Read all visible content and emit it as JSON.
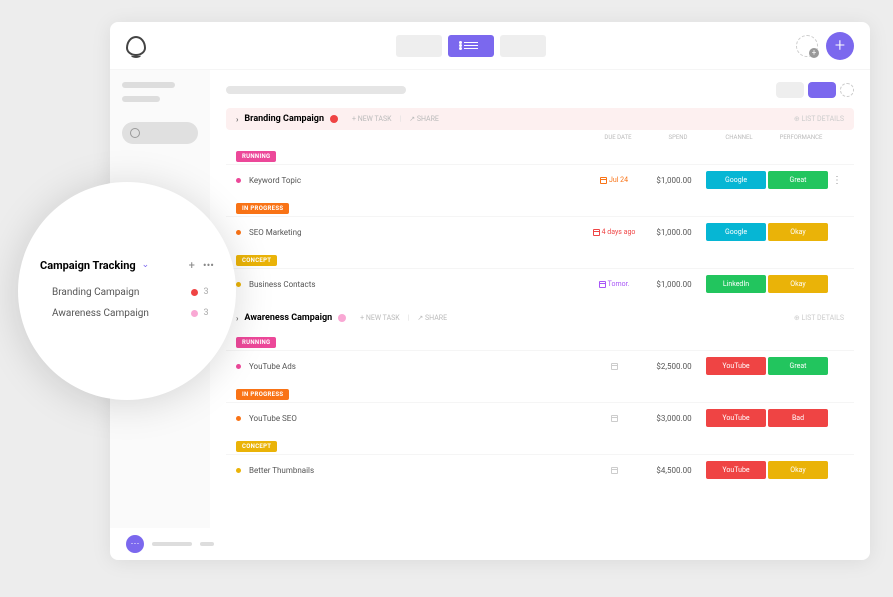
{
  "colors": {
    "purple": "#7b68ee",
    "pink": "#ec4899",
    "orange": "#f97316",
    "yellow": "#eab308",
    "red": "#ef4444",
    "green": "#22c55e",
    "blue": "#3b82f6",
    "gold": "#facc15"
  },
  "popup": {
    "title": "Campaign Tracking",
    "items": [
      {
        "label": "Branding Campaign",
        "dot": "#ef4444",
        "count": "3"
      },
      {
        "label": "Awareness Campaign",
        "dot": "#f9a8d4",
        "count": "3"
      }
    ]
  },
  "groups": [
    {
      "title": "Branding Campaign",
      "dot": "#ef4444",
      "headbg": "pink",
      "newtask": "+ NEW TASK",
      "share": "↗ SHARE",
      "details": "⊕ LIST DETAILS",
      "cols": {
        "c2": "DUE DATE",
        "c3": "SPEND",
        "c4": "CHANNEL",
        "c5": "PERFORMANCE"
      },
      "sections": [
        {
          "tag": "RUNNING",
          "tagc": "#ec4899",
          "rows": [
            {
              "bullet": "#ec4899",
              "name": "Keyword Topic",
              "date": "Jul 24",
              "datec": "#f97316",
              "spend": "$1,000.00",
              "t1": "Google",
              "t1c": "#06b6d4",
              "t2": "Great",
              "t2c": "#22c55e",
              "dots": true
            }
          ]
        },
        {
          "tag": "IN PROGRESS",
          "tagc": "#f97316",
          "rows": [
            {
              "bullet": "#f97316",
              "name": "SEO Marketing",
              "date": "4 days ago",
              "datec": "#ef4444",
              "spend": "$1,000.00",
              "t1": "Google",
              "t1c": "#06b6d4",
              "t2": "Okay",
              "t2c": "#eab308"
            }
          ]
        },
        {
          "tag": "CONCEPT",
          "tagc": "#eab308",
          "rows": [
            {
              "bullet": "#eab308",
              "name": "Business Contacts",
              "date": "Tomor.",
              "datec": "#a855f7",
              "spend": "$1,000.00",
              "t1": "LinkedIn",
              "t1c": "#22c55e",
              "t2": "Okay",
              "t2c": "#eab308"
            }
          ]
        }
      ]
    },
    {
      "title": "Awareness Campaign",
      "dot": "#f9a8d4",
      "headbg": "",
      "newtask": "+ NEW TASK",
      "share": "↗ SHARE",
      "details": "⊕ LIST DETAILS",
      "sections": [
        {
          "tag": "RUNNING",
          "tagc": "#ec4899",
          "rows": [
            {
              "bullet": "#ec4899",
              "name": "YouTube Ads",
              "date": "",
              "datec": "#ccc",
              "spend": "$2,500.00",
              "t1": "YouTube",
              "t1c": "#ef4444",
              "t2": "Great",
              "t2c": "#22c55e"
            }
          ]
        },
        {
          "tag": "IN PROGRESS",
          "tagc": "#f97316",
          "rows": [
            {
              "bullet": "#f97316",
              "name": "YouTube SEO",
              "date": "",
              "datec": "#ccc",
              "spend": "$3,000.00",
              "t1": "YouTube",
              "t1c": "#ef4444",
              "t2": "Bad",
              "t2c": "#ef4444"
            }
          ]
        },
        {
          "tag": "CONCEPT",
          "tagc": "#eab308",
          "rows": [
            {
              "bullet": "#eab308",
              "name": "Better Thumbnails",
              "date": "",
              "datec": "#ccc",
              "spend": "$4,500.00",
              "t1": "YouTube",
              "t1c": "#ef4444",
              "t2": "Okay",
              "t2c": "#eab308"
            }
          ]
        }
      ]
    }
  ]
}
